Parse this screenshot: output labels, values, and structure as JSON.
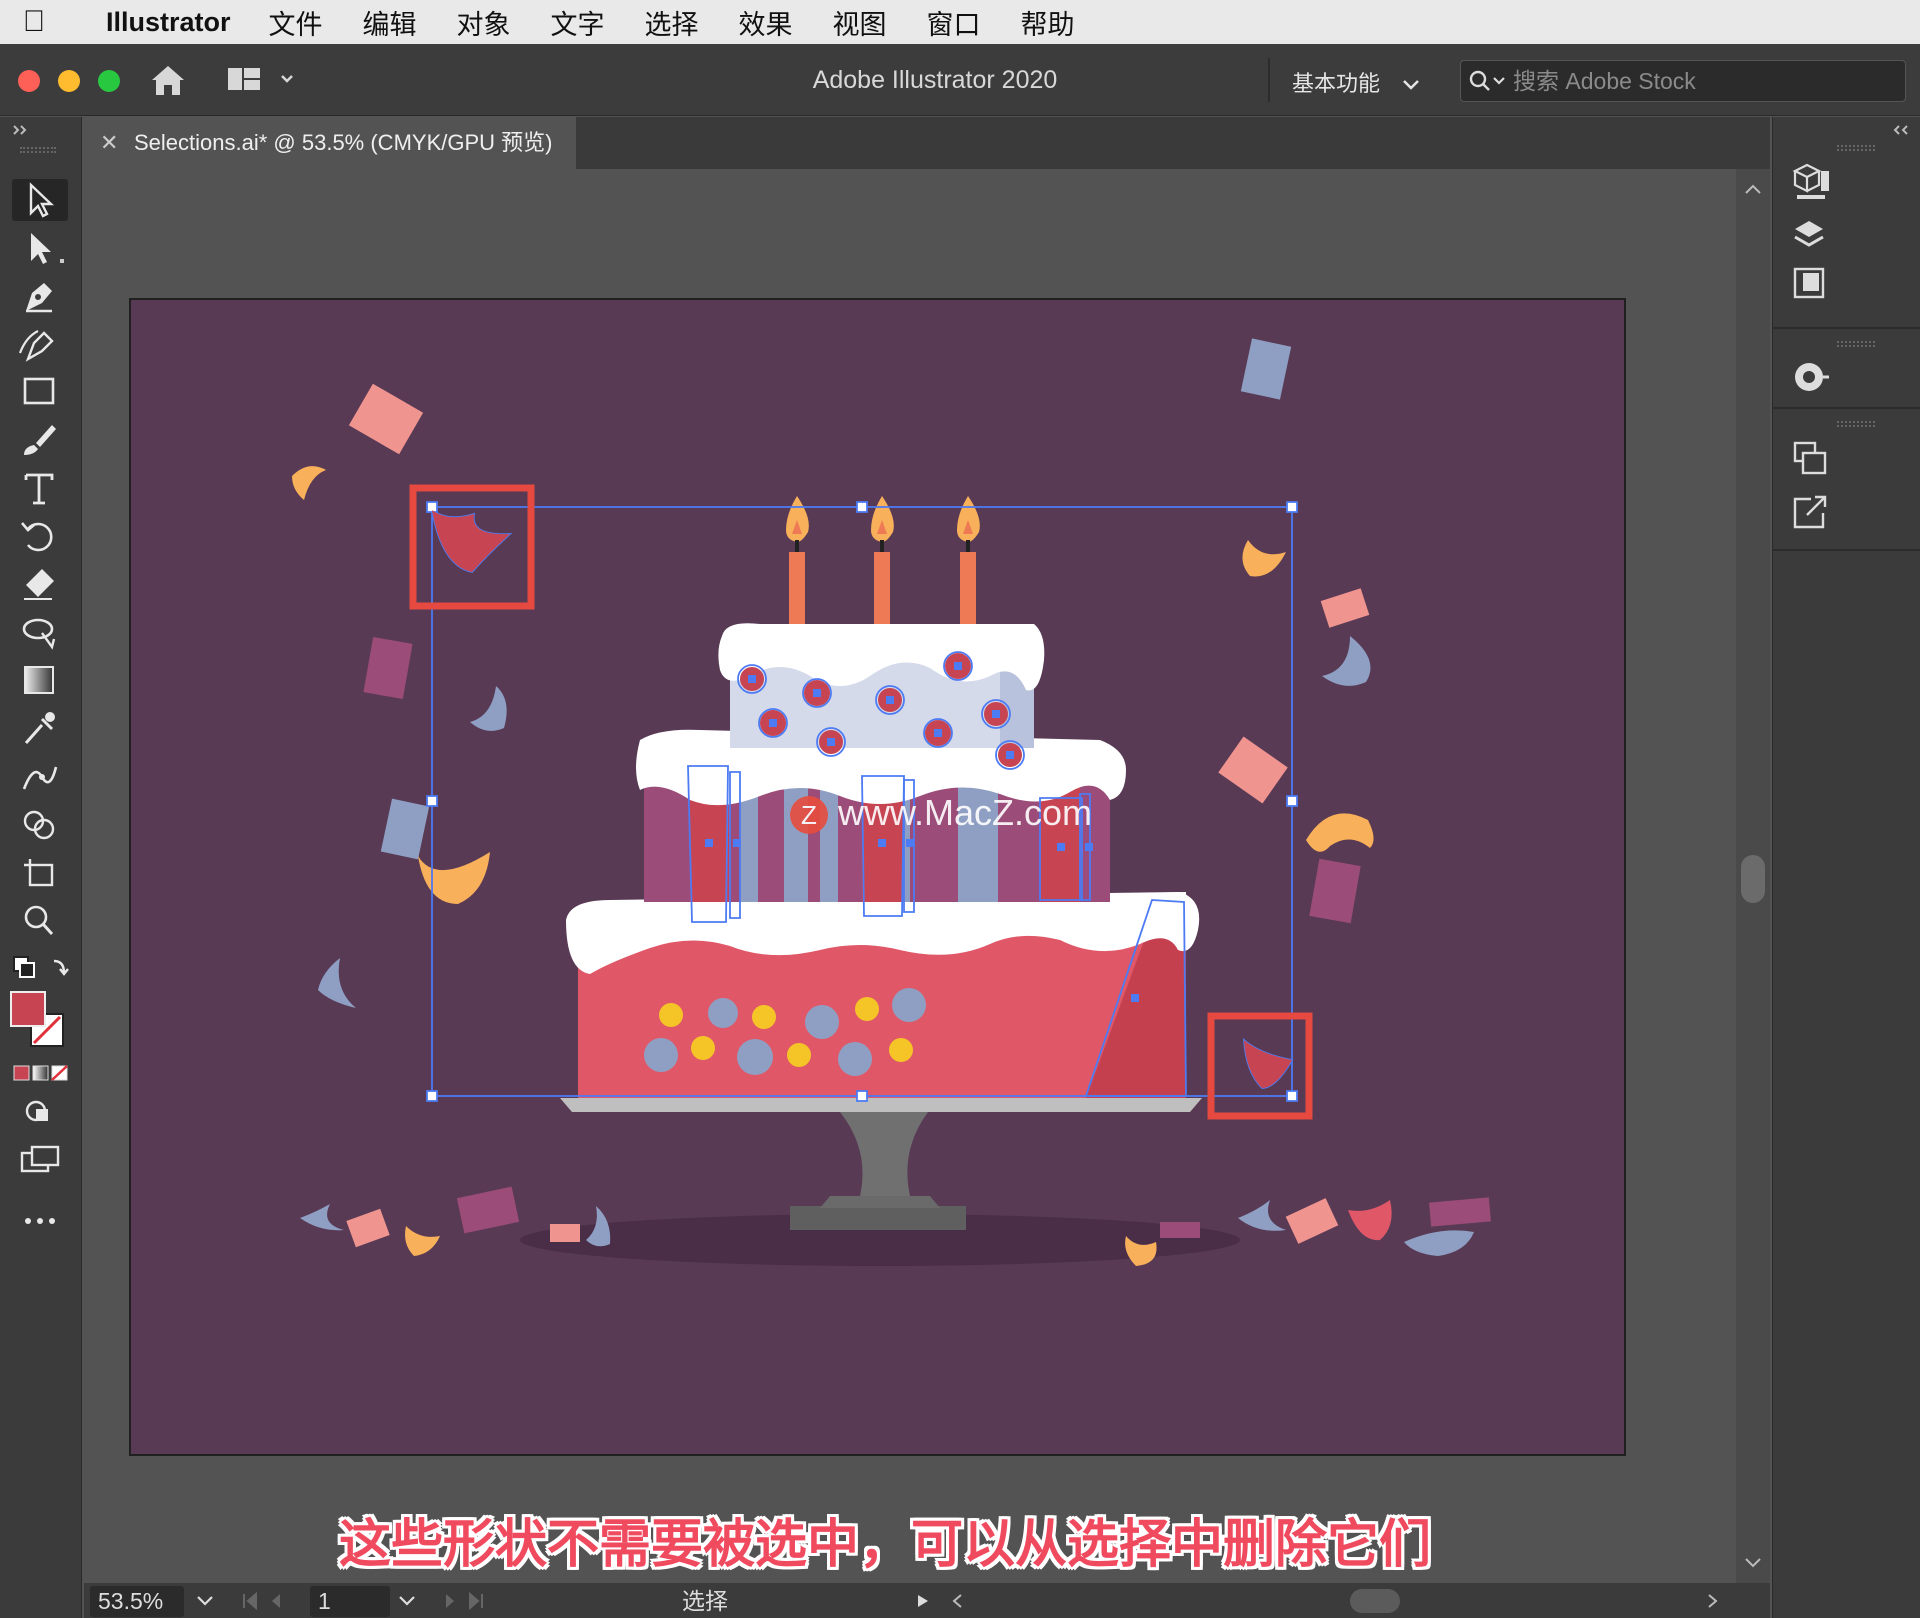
{
  "menubar": {
    "app_name": "Illustrator",
    "items": [
      "文件",
      "编辑",
      "对象",
      "文字",
      "选择",
      "效果",
      "视图",
      "窗口",
      "帮助"
    ]
  },
  "titlebar": {
    "title": "Adobe Illustrator 2020",
    "workspace": "基本功能",
    "search_placeholder": "搜索 Adobe Stock"
  },
  "document": {
    "tab_label": "Selections.ai* @ 53.5% (CMYK/GPU 预览)"
  },
  "statusbar": {
    "zoom": "53.5%",
    "page": "1",
    "tool_label": "选择"
  },
  "overlay": {
    "caption": "这些形状不需要被选中，可以从选择中删除它们",
    "watermark": "www.MacZ.com",
    "watermark_logo": "Z"
  },
  "colors": {
    "artboard": "#583a55",
    "highlight": "#e5493f",
    "selection": "#4d7bf3",
    "cake_red": "#e05868",
    "frosting": "#ffffff",
    "confetti_pink": "#f0948f",
    "confetti_blue": "#8f9fc3",
    "confetti_orange": "#f8b05a",
    "confetti_mauve": "#9b4c78"
  },
  "icons": {
    "left_toolbar": [
      "selection-tool-icon",
      "direct-selection-tool-icon",
      "pen-tool-icon",
      "curvature-tool-icon",
      "rectangle-tool-icon",
      "paintbrush-tool-icon",
      "type-tool-icon",
      "rotate-tool-icon",
      "eraser-tool-icon",
      "lasso-tool-icon",
      "gradient-tool-icon",
      "eyedropper-tool-icon",
      "puppet-warp-tool-icon",
      "shape-builder-tool-icon",
      "artboard-tool-icon",
      "zoom-tool-icon"
    ],
    "right_panel": [
      "libraries-icon",
      "layers-icon",
      "assets-icon",
      "color-wheel-icon",
      "transform-icon",
      "export-icon"
    ]
  }
}
